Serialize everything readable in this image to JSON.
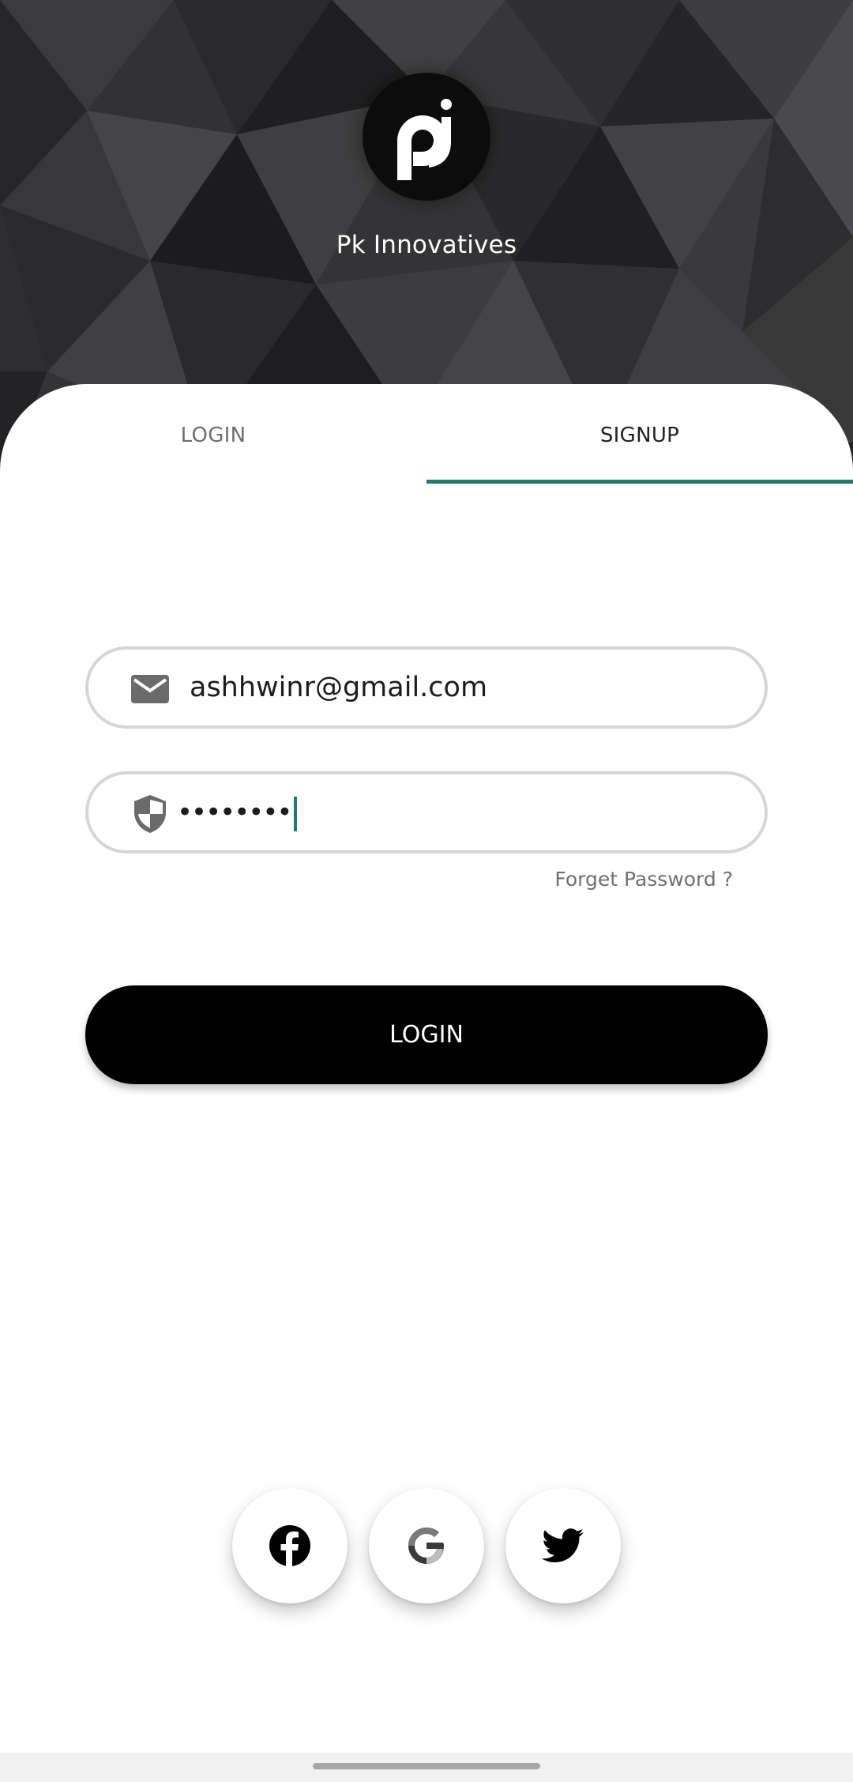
{
  "header": {
    "brand_name": "Pk Innovatives",
    "logo_icon": "pk-logo-icon",
    "background_color": "#2e2e30"
  },
  "tabs": [
    {
      "label": "LOGIN",
      "selected": false
    },
    {
      "label": "SIGNUP",
      "selected": true
    }
  ],
  "form": {
    "email": {
      "icon": "mail-icon",
      "value": "ashhwinr@gmail.com",
      "placeholder": ""
    },
    "password": {
      "icon": "shield-icon",
      "masked_value": "••••••••",
      "placeholder": ""
    },
    "forgot_label": "Forget Password ?",
    "submit_label": "LOGIN"
  },
  "social": [
    {
      "name": "facebook",
      "icon": "facebook-icon"
    },
    {
      "name": "google",
      "icon": "google-icon"
    },
    {
      "name": "twitter",
      "icon": "twitter-icon"
    }
  ],
  "colors": {
    "accent": "#1f7a67",
    "button": "#000000",
    "field_border": "#d6d6d6"
  }
}
